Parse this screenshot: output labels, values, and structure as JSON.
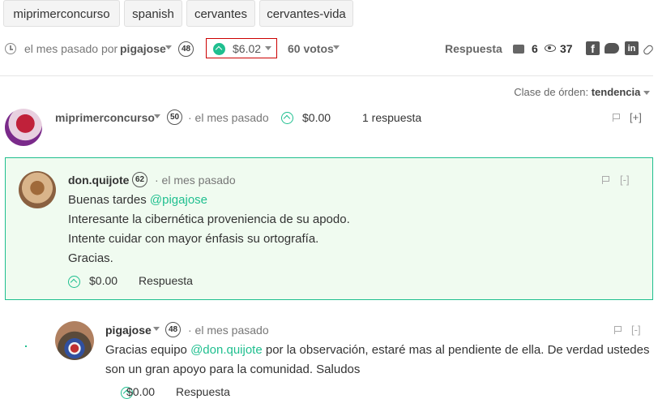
{
  "tags": [
    "miprimerconcurso",
    "spanish",
    "cervantes",
    "cervantes-vida"
  ],
  "post": {
    "time": "el mes pasado por",
    "author": "pigajose",
    "reputation": "48",
    "payout": "$6.02",
    "votes": "60 votos",
    "reply_label": "Respuesta",
    "comment_count": "6",
    "view_count": "37"
  },
  "sort": {
    "label": "Clase de órden:",
    "value": "tendencia"
  },
  "comments": [
    {
      "author": "miprimerconcurso",
      "reputation": "50",
      "time": "· el mes pasado",
      "payout": "$0.00",
      "replies": "1 respuesta",
      "toggle": "[+]"
    },
    {
      "author": "don.quijote",
      "reputation": "62",
      "time": "· el mes pasado",
      "toggle": "[-]",
      "line1_prefix": "Buenas tardes ",
      "line1_mention": "@pigajose",
      "line2": "Interesante la cibernética proveniencia de su apodo.",
      "line3": "Intente cuidar con mayor énfasis su ortografía.",
      "line4": "Gracias.",
      "payout": "$0.00",
      "reply_label": "Respuesta"
    },
    {
      "author": "pigajose",
      "reputation": "48",
      "time": "· el mes pasado",
      "toggle": "[-]",
      "text_prefix": "Gracias equipo ",
      "text_mention": "@don.quijote",
      "text_rest": " por la observación, estaré mas al pendiente de ella. De verdad ustedes",
      "line2": "son un gran apoyo para la comunidad. Saludos",
      "payout": "$0.00",
      "reply_label": "Respuesta"
    }
  ],
  "colors": {
    "accent": "#1fbf8f",
    "highlight_bg": "#f0fbf0",
    "payout_box": "#cc0000"
  }
}
